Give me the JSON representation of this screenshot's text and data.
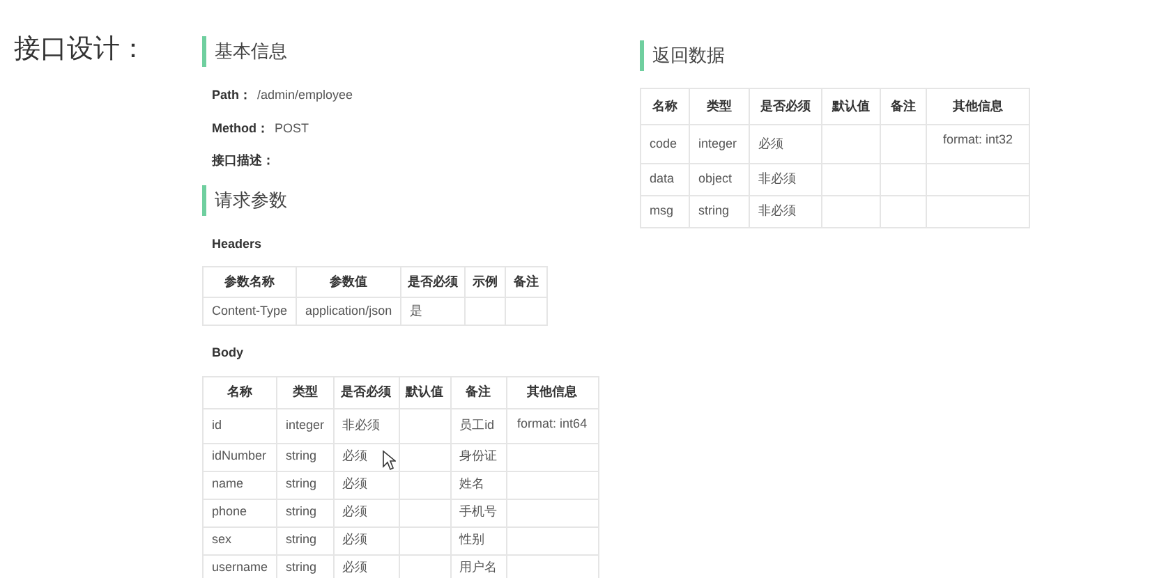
{
  "title": "接口设计：",
  "basic": {
    "heading": "基本信息",
    "path_label": "Path：",
    "path": "/admin/employee",
    "method_label": "Method：",
    "method": "POST",
    "desc_label": "接口描述："
  },
  "request": {
    "heading": "请求参数",
    "headers_label": "Headers",
    "headers_table": {
      "columns": [
        "参数名称",
        "参数值",
        "是否必须",
        "示例",
        "备注"
      ],
      "rows": [
        [
          "Content-Type",
          "application/json",
          "是",
          "",
          ""
        ]
      ]
    },
    "body_label": "Body",
    "body_table": {
      "columns": [
        "名称",
        "类型",
        "是否必须",
        "默认值",
        "备注",
        "其他信息"
      ],
      "rows": [
        [
          "id",
          "integer",
          "非必须",
          "",
          "员工id",
          "format: int64"
        ],
        [
          "idNumber",
          "string",
          "必须",
          "",
          "身份证",
          ""
        ],
        [
          "name",
          "string",
          "必须",
          "",
          "姓名",
          ""
        ],
        [
          "phone",
          "string",
          "必须",
          "",
          "手机号",
          ""
        ],
        [
          "sex",
          "string",
          "必须",
          "",
          "性别",
          ""
        ],
        [
          "username",
          "string",
          "必须",
          "",
          "用户名",
          ""
        ]
      ]
    }
  },
  "response": {
    "heading": "返回数据",
    "table": {
      "columns": [
        "名称",
        "类型",
        "是否必须",
        "默认值",
        "备注",
        "其他信息"
      ],
      "rows": [
        [
          "code",
          "integer",
          "必须",
          "",
          "",
          "format: int32"
        ],
        [
          "data",
          "object",
          "非必须",
          "",
          "",
          ""
        ],
        [
          "msg",
          "string",
          "非必须",
          "",
          "",
          ""
        ]
      ]
    }
  }
}
